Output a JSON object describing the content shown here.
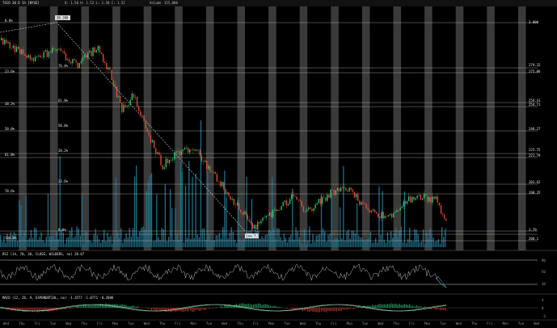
{
  "header": {
    "symbol": "TSCO 30 D 1h [NYSE]",
    "ohlc": "O: 1.50  H: 1.52  L: 1.50  C: 1.52",
    "volume_label": "Volume",
    "volume_value": "155,000"
  },
  "colors": {
    "background": "#000000",
    "band": "#3a3a3a",
    "up_candle": "#2ecc71",
    "down_candle": "#e74c3c",
    "volume": "#1e6d8a",
    "fib_line": "#d8d8c0",
    "trendline": "#cfcfcf",
    "rsi_line": "#cccccc",
    "rsi_low": "#18b8c8",
    "macd_line": "#5cd08a",
    "signal_line": "#cccccc",
    "hist_up": "#2aa86a",
    "hist_down": "#c0392b"
  },
  "price_panel": {
    "top_marker": "30.308",
    "bottom_marker": "Low 7.98",
    "fib_left": [
      "0.0%",
      "23.6%",
      "38.2%",
      "50.0%",
      "61.8%",
      "78.6%",
      "100.0%"
    ],
    "fib_mid": [
      "76.4%",
      "61.8%",
      "50.0%",
      "38.2%",
      "23.6%",
      "0.0%"
    ],
    "right_labels": [
      "3.000",
      "279.32",
      "275.06",
      "259.41",
      "254.71",
      "248.27",
      "225.75",
      "221.79",
      "203.62",
      "190.35",
      "3.79",
      "200.1"
    ]
  },
  "rsi_panel": {
    "label": "RSI (14, 70, 30, CLOSE, WILDERS, no)  28.67",
    "scale": [
      "90",
      "50",
      "10"
    ]
  },
  "macd_panel": {
    "label": "MACD (12, 26, 9, EXPONENTIAL, no)  -1.3577  -1.0771  -0.2806",
    "scale": [
      "4",
      "0",
      "-3"
    ]
  },
  "x_axis": {
    "labels": [
      "Wed",
      "Thu",
      "Fri",
      "Tue",
      "Wed",
      "Thu",
      "Fri",
      "Mon",
      "Tue",
      "Wed",
      "Thu",
      "Fri",
      "Mon",
      "Tue",
      "Wed",
      "Thu",
      "Fri",
      "Mon",
      "Tue",
      "Wed",
      "Thu",
      "Fri",
      "Mon",
      "Tue",
      "Wed",
      "Thu",
      "Fri",
      "Mon",
      "Tue",
      "Wed",
      "Thu",
      "Fri",
      "Mon",
      "Tue",
      "Wed"
    ]
  }
}
